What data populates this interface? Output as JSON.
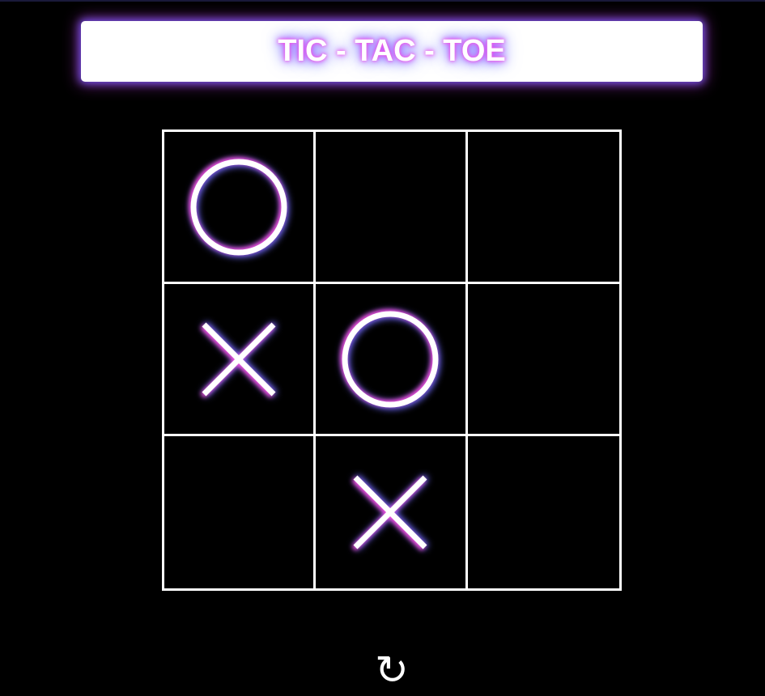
{
  "title": "TIC - TAC - TOE",
  "board": {
    "cells": [
      "O",
      "",
      "",
      "X",
      "O",
      "",
      "",
      "X",
      ""
    ]
  },
  "reset": {
    "icon": "reset-icon",
    "glyph": "↻"
  },
  "colors": {
    "background": "#000000",
    "line": "#ffffff",
    "glow_pink": "#ff4fe0",
    "glow_blue": "#6f6bff"
  }
}
